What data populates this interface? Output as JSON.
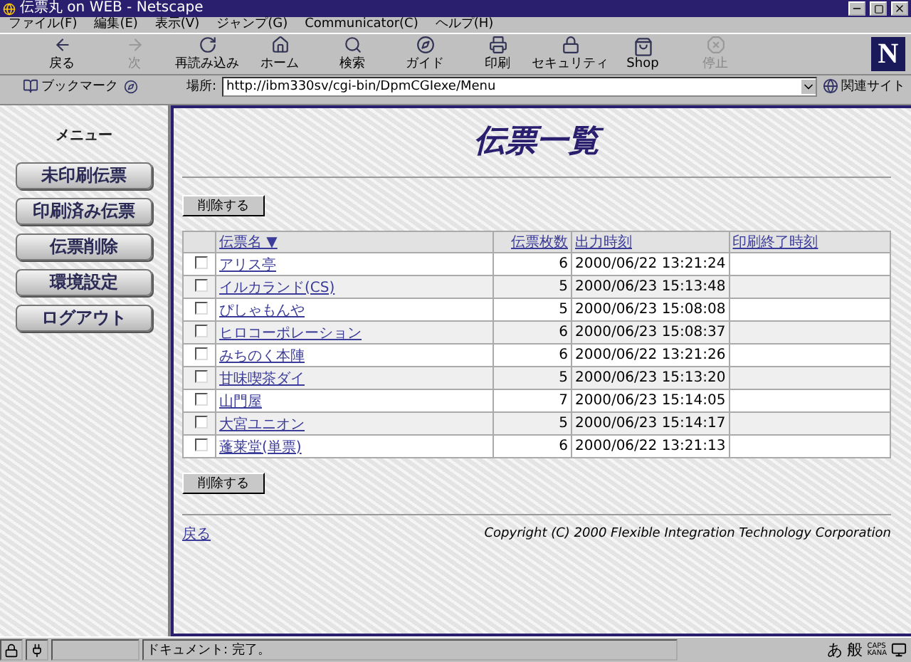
{
  "window": {
    "title": "伝票丸 on WEB - Netscape"
  },
  "menu_bar": [
    "ファイル(F)",
    "編集(E)",
    "表示(V)",
    "ジャンプ(G)",
    "Communicator(C)",
    "ヘルプ(H)"
  ],
  "toolbar": [
    {
      "label": "戻る",
      "kind": "back",
      "disabled": false
    },
    {
      "label": "次",
      "kind": "forward",
      "disabled": true
    },
    {
      "label": "再読み込み",
      "kind": "reload",
      "disabled": false
    },
    {
      "label": "ホーム",
      "kind": "home",
      "disabled": false
    },
    {
      "label": "検索",
      "kind": "search",
      "disabled": false
    },
    {
      "label": "ガイド",
      "kind": "guide",
      "disabled": false
    },
    {
      "label": "印刷",
      "kind": "print",
      "disabled": false
    },
    {
      "label": "セキュリティ",
      "kind": "security",
      "disabled": false
    },
    {
      "label": "Shop",
      "kind": "shop",
      "disabled": false
    },
    {
      "label": "停止",
      "kind": "stop",
      "disabled": true
    }
  ],
  "logo": "N",
  "location_bar": {
    "bookmarks": "ブックマーク",
    "location_label": "場所:",
    "url": "http://ibm330sv/cgi-bin/DpmCGIexe/Menu",
    "related": "関連サイト"
  },
  "sidebar": {
    "heading": "メニュー",
    "buttons": [
      "未印刷伝票",
      "印刷済み伝票",
      "伝票削除",
      "環境設定",
      "ログアウト"
    ]
  },
  "main": {
    "title": "伝票一覧",
    "delete_button_top": "削除する",
    "table": {
      "columns": [
        "伝票名 ▼",
        "伝票枚数",
        "出力時刻",
        "印刷終了時刻"
      ],
      "rows": [
        {
          "checked": false,
          "name": "アリス亭",
          "count": "6",
          "output_time": "2000/06/22 13:21:24"
        },
        {
          "checked": false,
          "name": "イルカランド(CS)",
          "count": "5",
          "output_time": "2000/06/23 15:13:48"
        },
        {
          "checked": false,
          "name": "ぴしゃもんや",
          "count": "5",
          "output_time": "2000/06/23 15:08:08"
        },
        {
          "checked": false,
          "name": "ヒロコーポレーション",
          "count": "6",
          "output_time": "2000/06/23 15:08:37"
        },
        {
          "checked": false,
          "name": "みちのく本陣",
          "count": "6",
          "output_time": "2000/06/22 13:21:26"
        },
        {
          "checked": false,
          "name": "甘味喫茶ダイ",
          "count": "5",
          "output_time": "2000/06/23 15:13:20"
        },
        {
          "checked": false,
          "name": "山門屋",
          "count": "7",
          "output_time": "2000/06/23 15:14:05"
        },
        {
          "checked": false,
          "name": "大宮ユニオン",
          "count": "5",
          "output_time": "2000/06/23 15:14:17"
        },
        {
          "checked": false,
          "name": "蓬莱堂(単票)",
          "count": "6",
          "output_time": "2000/06/22 13:21:13"
        }
      ]
    },
    "delete_button_bottom": "削除する",
    "back_link": "戻る",
    "copyright": "Copyright (C) 2000 Flexible Integration Technology Corporation"
  },
  "status_bar": {
    "text": "ドキュメント: 完了。",
    "ime": [
      "あ",
      "般"
    ],
    "caps": "CAPS",
    "kana": "KANA"
  }
}
